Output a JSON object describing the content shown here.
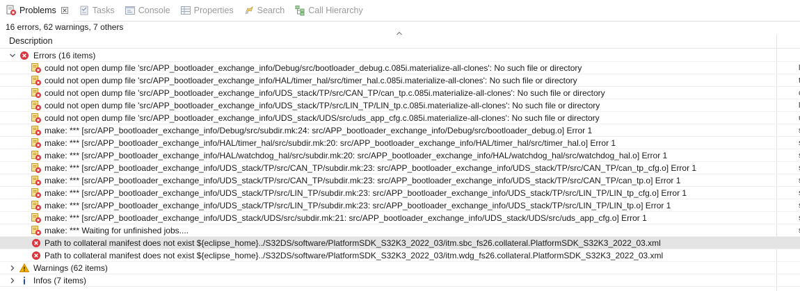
{
  "tabs": [
    {
      "id": "problems",
      "label": "Problems",
      "icon": "problems-icon",
      "active": true
    },
    {
      "id": "tasks",
      "label": "Tasks",
      "icon": "tasks-icon",
      "active": false
    },
    {
      "id": "console",
      "label": "Console",
      "icon": "console-icon",
      "active": false
    },
    {
      "id": "properties",
      "label": "Properties",
      "icon": "properties-icon",
      "active": false
    },
    {
      "id": "search",
      "label": "Search",
      "icon": "search-icon",
      "active": false
    },
    {
      "id": "call_hierarchy",
      "label": "Call Hierarchy",
      "icon": "call-hierarchy-icon",
      "active": false
    }
  ],
  "summary": "16 errors, 62 warnings, 7 others",
  "header": {
    "description": "Description"
  },
  "groups": {
    "errors": {
      "label": "Errors (16 items)",
      "expanded": true,
      "icon": "error-icon"
    },
    "warnings": {
      "label": "Warnings (62 items)",
      "expanded": false,
      "icon": "warning-icon"
    },
    "infos": {
      "label": "Infos (7 items)",
      "expanded": false,
      "icon": "info-icon"
    }
  },
  "errors": [
    {
      "text": "could not open dump file 'src/APP_bootloader_exchange_info/Debug/src/bootloader_debug.c.085i.materialize-all-clones': No such file or directory",
      "icon": "make-error-icon",
      "edge": "l"
    },
    {
      "text": "could not open dump file 'src/APP_bootloader_exchange_info/HAL/timer_hal/src/timer_hal.c.085i.materialize-all-clones': No such file or directory",
      "icon": "make-error-icon",
      "edge": "t"
    },
    {
      "text": "could not open dump file 'src/APP_bootloader_exchange_info/UDS_stack/TP/src/CAN_TP/can_tp.c.085i.materialize-all-clones': No such file or directory",
      "icon": "make-error-icon",
      "edge": "c"
    },
    {
      "text": "could not open dump file 'src/APP_bootloader_exchange_info/UDS_stack/TP/src/LIN_TP/LIN_tp.c.085i.materialize-all-clones': No such file or directory",
      "icon": "make-error-icon",
      "edge": "l"
    },
    {
      "text": "could not open dump file 'src/APP_bootloader_exchange_info/UDS_stack/UDS/src/uds_app_cfg.c.085i.materialize-all-clones': No such file or directory",
      "icon": "make-error-icon",
      "edge": "u"
    },
    {
      "text": "make: *** [src/APP_bootloader_exchange_info/Debug/src/subdir.mk:24: src/APP_bootloader_exchange_info/Debug/src/bootloader_debug.o] Error 1",
      "icon": "make-error-icon",
      "edge": "s"
    },
    {
      "text": "make: *** [src/APP_bootloader_exchange_info/HAL/timer_hal/src/subdir.mk:20: src/APP_bootloader_exchange_info/HAL/timer_hal/src/timer_hal.o] Error 1",
      "icon": "make-error-icon",
      "edge": "s"
    },
    {
      "text": "make: *** [src/APP_bootloader_exchange_info/HAL/watchdog_hal/src/subdir.mk:20: src/APP_bootloader_exchange_info/HAL/watchdog_hal/src/watchdog_hal.o] Error 1",
      "icon": "make-error-icon",
      "edge": "s"
    },
    {
      "text": "make: *** [src/APP_bootloader_exchange_info/UDS_stack/TP/src/CAN_TP/subdir.mk:23: src/APP_bootloader_exchange_info/UDS_stack/TP/src/CAN_TP/can_tp_cfg.o] Error 1",
      "icon": "make-error-icon",
      "edge": "s"
    },
    {
      "text": "make: *** [src/APP_bootloader_exchange_info/UDS_stack/TP/src/CAN_TP/subdir.mk:23: src/APP_bootloader_exchange_info/UDS_stack/TP/src/CAN_TP/can_tp.o] Error 1",
      "icon": "make-error-icon",
      "edge": "s"
    },
    {
      "text": "make: *** [src/APP_bootloader_exchange_info/UDS_stack/TP/src/LIN_TP/subdir.mk:23: src/APP_bootloader_exchange_info/UDS_stack/TP/src/LIN_TP/LIN_tp_cfg.o] Error 1",
      "icon": "make-error-icon",
      "edge": "s"
    },
    {
      "text": "make: *** [src/APP_bootloader_exchange_info/UDS_stack/TP/src/LIN_TP/subdir.mk:23: src/APP_bootloader_exchange_info/UDS_stack/TP/src/LIN_TP/LIN_tp.o] Error 1",
      "icon": "make-error-icon",
      "edge": "s"
    },
    {
      "text": "make: *** [src/APP_bootloader_exchange_info/UDS_stack/UDS/src/subdir.mk:21: src/APP_bootloader_exchange_info/UDS_stack/UDS/src/uds_app_cfg.o] Error 1",
      "icon": "make-error-icon",
      "edge": "s"
    },
    {
      "text": "make: *** Waiting for unfinished jobs....",
      "icon": "make-error-icon",
      "edge": "s"
    },
    {
      "text": "Path to collateral manifest does not exist ${eclipse_home}../S32DS/software/PlatformSDK_S32K3_2022_03/itm.sbc_fs26.collateral.PlatformSDK_S32K3_2022_03.xml",
      "icon": "error-icon",
      "edge": "",
      "selected": true
    },
    {
      "text": "Path to collateral manifest does not exist ${eclipse_home}../S32DS/software/PlatformSDK_S32K3_2022_03/itm.wdg_fs26.collateral.PlatformSDK_S32K3_2022_03.xml",
      "icon": "error-icon",
      "edge": ""
    }
  ],
  "colors": {
    "error": "#d9363e",
    "warning": "#e8a400",
    "info": "#2a4f9e",
    "make_doc": "#d9a72c",
    "selected_row": "#e4e4e4"
  }
}
